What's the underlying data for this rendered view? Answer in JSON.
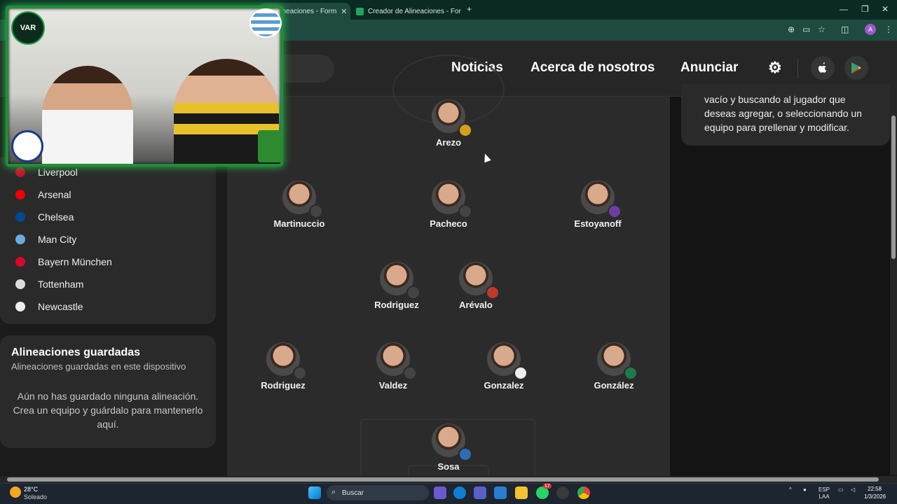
{
  "browser": {
    "tabs": [
      {
        "title": "de Alineaciones - Form",
        "active": true
      },
      {
        "title": "Creador de Alineaciones - Form",
        "active": false
      }
    ],
    "new_tab": "+",
    "controls": {
      "minimize": "—",
      "restore": "❐",
      "close": "✕"
    },
    "toolbar_icons": [
      "zoom-icon",
      "cast-icon",
      "bookmark-star-icon",
      "extensions-icon"
    ],
    "profile_initial": "A",
    "menu": "⋮"
  },
  "nav": {
    "links": [
      "Noticias",
      "Acerca de nosotros",
      "Anunciar"
    ],
    "settings_icon": "⚙",
    "apple_icon": "",
    "play_icon": "▶"
  },
  "sidebar": {
    "teams": [
      {
        "name": "Liverpool",
        "color": "#c8102e"
      },
      {
        "name": "Arsenal",
        "color": "#ef0107"
      },
      {
        "name": "Chelsea",
        "color": "#034694"
      },
      {
        "name": "Man City",
        "color": "#6cabdd"
      },
      {
        "name": "Bayern München",
        "color": "#dc052d"
      },
      {
        "name": "Tottenham",
        "color": "#dddddd"
      },
      {
        "name": "Newcastle",
        "color": "#eeeeee"
      }
    ],
    "saved": {
      "title": "Alineaciones guardadas",
      "subtitle": "Alineaciones guardadas en este dispositivo",
      "empty": "Aún no has guardado ninguna alineación. Crea un equipo y guárdalo para mantenerlo aquí."
    }
  },
  "lineup": {
    "players": [
      {
        "name": "Arezo",
        "badge": "#d4a017"
      },
      {
        "name": "Martinuccio",
        "badge": "#444444"
      },
      {
        "name": "Pacheco",
        "badge": "#444444"
      },
      {
        "name": "Estoyanoff",
        "badge": "#6b3fa0"
      },
      {
        "name": "Rodriguez",
        "badge": "#444444"
      },
      {
        "name": "Arévalo",
        "badge": "#c0392b"
      },
      {
        "name": "Rodriguez",
        "badge": "#444444"
      },
      {
        "name": "Valdez",
        "badge": "#444444"
      },
      {
        "name": "Gonzalez",
        "badge": "#eeeeee"
      },
      {
        "name": "González",
        "badge": "#1e7a4a"
      },
      {
        "name": "Sosa",
        "badge": "#2f6db5"
      }
    ]
  },
  "info": {
    "text": "vacío y buscando al jugador que deseas agregar, o seleccionando un equipo para prellenar y modificar."
  },
  "webcam": {
    "logo": "VAR",
    "flag": "Uruguay"
  },
  "taskbar": {
    "weather_temp": "28°C",
    "weather_cond": "Soleado",
    "search_placeholder": "Buscar",
    "lang_1": "ESP",
    "lang_2": "LAA",
    "time": "22:58",
    "date": "1/3/2026",
    "whatsapp_badge": "17"
  }
}
